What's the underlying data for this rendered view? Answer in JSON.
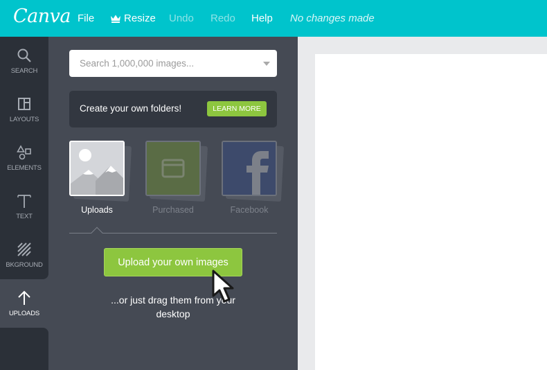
{
  "topbar": {
    "logo": "Canva",
    "menu": {
      "file": "File",
      "resize": "Resize",
      "undo": "Undo",
      "redo": "Redo",
      "help": "Help"
    },
    "status": "No changes made"
  },
  "rail": {
    "items": [
      {
        "label": "SEARCH",
        "icon": "search-icon"
      },
      {
        "label": "LAYOUTS",
        "icon": "layouts-icon"
      },
      {
        "label": "ELEMENTS",
        "icon": "elements-icon"
      },
      {
        "label": "TEXT",
        "icon": "text-icon"
      },
      {
        "label": "BKGROUND",
        "icon": "background-icon"
      },
      {
        "label": "UPLOADS",
        "icon": "upload-arrow-icon",
        "active": true
      }
    ]
  },
  "panel": {
    "search": {
      "placeholder": "Search 1,000,000 images...",
      "value": ""
    },
    "promo": {
      "text": "Create your own folders!",
      "button": "LEARN MORE"
    },
    "sources": [
      {
        "label": "Uploads",
        "active": true
      },
      {
        "label": "Purchased",
        "active": false
      },
      {
        "label": "Facebook",
        "active": false
      }
    ],
    "upload_button": "Upload your own images",
    "hint": "...or just drag them from your desktop"
  },
  "colors": {
    "brand": "#00c4cc",
    "accent_green": "#8dc63f",
    "panel_bg": "#454a54",
    "rail_bg": "#2b3038"
  }
}
